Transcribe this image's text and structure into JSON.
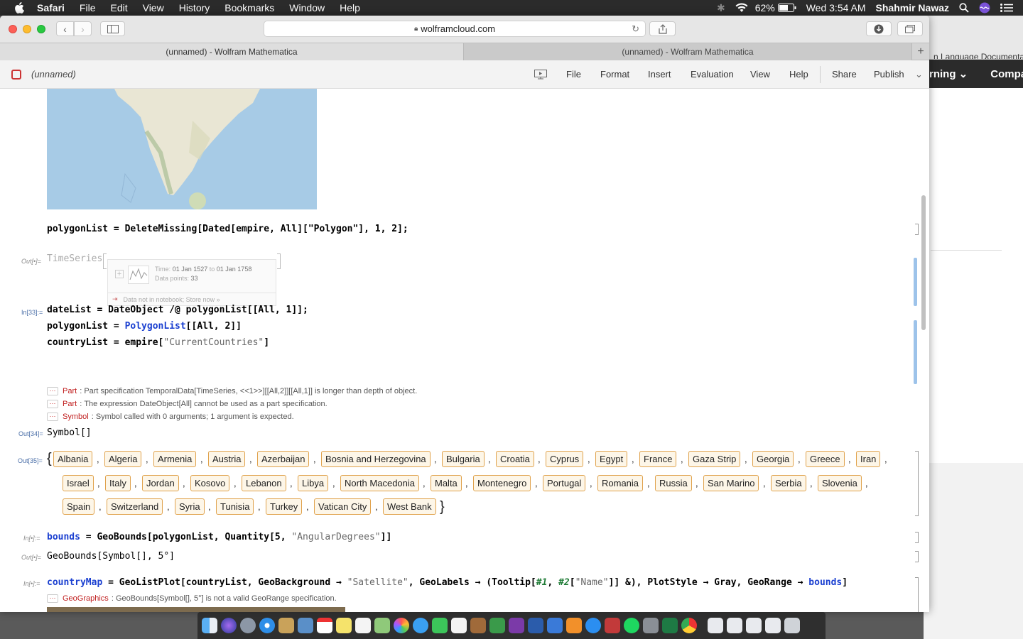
{
  "menubar": {
    "app": "Safari",
    "items": [
      "File",
      "Edit",
      "View",
      "History",
      "Bookmarks",
      "Window",
      "Help"
    ],
    "battery": "62%",
    "clock": "Wed 3:54 AM",
    "user": "Shahmir Nawaz"
  },
  "safari": {
    "url": "wolframcloud.com",
    "tabs": [
      "(unnamed) - Wolfram Mathematica",
      "(unnamed) - Wolfram Mathematica"
    ]
  },
  "background_window": {
    "tab_text": "n Language Documentation",
    "nav_item1": "rning",
    "nav_item2": "Company"
  },
  "mathematica": {
    "title": "(unnamed)",
    "menu": [
      "File",
      "Format",
      "Insert",
      "Evaluation",
      "View",
      "Help",
      "Share",
      "Publish"
    ]
  },
  "notebook": {
    "line1": "polygonList = DeleteMissing[Dated[empire, All][\"Polygon\"], 1, 2];",
    "out_label1": "Out[•]=",
    "timeseries_head": "TimeSeries",
    "ts_time_label": "Time:",
    "ts_time_from": "01 Jan 1527",
    "ts_to": "to",
    "ts_time_to": "01 Jan 1758",
    "ts_points_label": "Data points:",
    "ts_points": "33",
    "ts_store": "Data not in notebook; Store now »",
    "in33_label": "In[33]:=",
    "in33_line1": "dateList = DateObject /@ polygonList[[All, 1]];",
    "in33_line2_a": "polygonList = ",
    "in33_line2_b": "PolygonList",
    "in33_line2_c": "[[All, 2]]",
    "in33_line3_a": "countryList = empire[",
    "in33_line3_b": "\"CurrentCountries\"",
    "in33_line3_c": "]",
    "messages": [
      {
        "sym": "Part",
        "text": "Part specification TemporalData[TimeSeries, <<1>>][[All,2]][[All,1]] is longer than depth of object."
      },
      {
        "sym": "Part",
        "text": "The expression DateObject[All] cannot be used as a part specification."
      },
      {
        "sym": "Symbol",
        "text": "Symbol called with 0 arguments; 1 argument is expected."
      }
    ],
    "out34_label": "Out[34]=",
    "out34": "Symbol[]",
    "out35_label": "Out[35]=",
    "countries": [
      [
        "Albania",
        "Algeria",
        "Armenia",
        "Austria",
        "Azerbaijan",
        "Bosnia and Herzegovina",
        "Bulgaria",
        "Croatia",
        "Cyprus",
        "Egypt",
        "France",
        "Gaza Strip",
        "Georgia",
        "Greece",
        "Iran"
      ],
      [
        "Israel",
        "Italy",
        "Jordan",
        "Kosovo",
        "Lebanon",
        "Libya",
        "North Macedonia",
        "Malta",
        "Montenegro",
        "Portugal",
        "Romania",
        "Russia",
        "San Marino",
        "Serbia",
        "Slovenia"
      ],
      [
        "Spain",
        "Switzerland",
        "Syria",
        "Tunisia",
        "Turkey",
        "Vatican City",
        "West Bank"
      ]
    ],
    "in_label_bounds": "In[•]:=",
    "bounds_a": "bounds",
    "bounds_b": " = GeoBounds[polygonList, Quantity[5, ",
    "bounds_c": "\"AngularDegrees\"",
    "bounds_d": "]]",
    "out_label_bounds": "Out[•]=",
    "bounds_out": "GeoBounds[Symbol[], 5°]",
    "in_label_map": "In[•]:=",
    "map_a": "countryMap",
    "map_b": " = GeoListPlot[countryList, GeoBackground → ",
    "map_c": "\"Satellite\"",
    "map_d": ", GeoLabels → (Tooltip[",
    "map_e": "#1",
    "map_f": ", ",
    "map_g": "#2",
    "map_h": "[",
    "map_i": "\"Name\"",
    "map_j": "]] &), PlotStyle → Gray, GeoRange → ",
    "map_k": "bounds",
    "map_l": "]",
    "geo_msg_sym": "GeoGraphics",
    "geo_msg": "GeoBounds[Symbol[], 5°] is not a valid GeoRange specification."
  },
  "colors": {
    "entity_border": "#e0a24c",
    "message_red": "#c01e1e",
    "symbol_blue": "#1a3fd0"
  }
}
